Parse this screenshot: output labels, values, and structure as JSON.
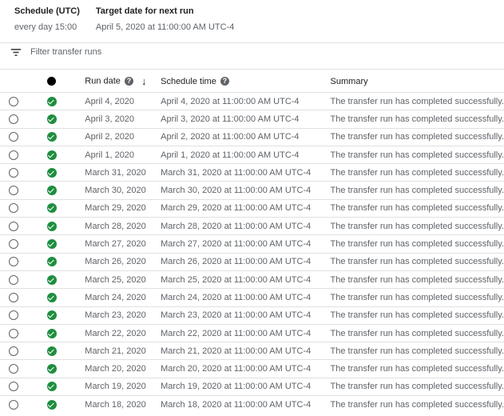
{
  "schedule": {
    "schedule_label": "Schedule (UTC)",
    "schedule_value": "every day 15:00",
    "target_label": "Target date for next run",
    "target_value": "April 5, 2020 at 11:00:00 AM UTC-4"
  },
  "filter": {
    "placeholder": "Filter transfer runs",
    "icon": "filter-icon"
  },
  "table": {
    "headers": {
      "run_date": "Run date",
      "schedule_time": "Schedule time",
      "summary": "Summary",
      "help_glyph": "?",
      "sort_glyph": "↓"
    },
    "status_color": "#1e8e3e",
    "rows": [
      {
        "run_date": "April 4, 2020",
        "schedule_time": "April 4, 2020 at 11:00:00 AM UTC-4",
        "summary": "The transfer run has completed successfully."
      },
      {
        "run_date": "April 3, 2020",
        "schedule_time": "April 3, 2020 at 11:00:00 AM UTC-4",
        "summary": "The transfer run has completed successfully."
      },
      {
        "run_date": "April 2, 2020",
        "schedule_time": "April 2, 2020 at 11:00:00 AM UTC-4",
        "summary": "The transfer run has completed successfully."
      },
      {
        "run_date": "April 1, 2020",
        "schedule_time": "April 1, 2020 at 11:00:00 AM UTC-4",
        "summary": "The transfer run has completed successfully."
      },
      {
        "run_date": "March 31, 2020",
        "schedule_time": "March 31, 2020 at 11:00:00 AM UTC-4",
        "summary": "The transfer run has completed successfully."
      },
      {
        "run_date": "March 30, 2020",
        "schedule_time": "March 30, 2020 at 11:00:00 AM UTC-4",
        "summary": "The transfer run has completed successfully."
      },
      {
        "run_date": "March 29, 2020",
        "schedule_time": "March 29, 2020 at 11:00:00 AM UTC-4",
        "summary": "The transfer run has completed successfully."
      },
      {
        "run_date": "March 28, 2020",
        "schedule_time": "March 28, 2020 at 11:00:00 AM UTC-4",
        "summary": "The transfer run has completed successfully."
      },
      {
        "run_date": "March 27, 2020",
        "schedule_time": "March 27, 2020 at 11:00:00 AM UTC-4",
        "summary": "The transfer run has completed successfully."
      },
      {
        "run_date": "March 26, 2020",
        "schedule_time": "March 26, 2020 at 11:00:00 AM UTC-4",
        "summary": "The transfer run has completed successfully."
      },
      {
        "run_date": "March 25, 2020",
        "schedule_time": "March 25, 2020 at 11:00:00 AM UTC-4",
        "summary": "The transfer run has completed successfully."
      },
      {
        "run_date": "March 24, 2020",
        "schedule_time": "March 24, 2020 at 11:00:00 AM UTC-4",
        "summary": "The transfer run has completed successfully."
      },
      {
        "run_date": "March 23, 2020",
        "schedule_time": "March 23, 2020 at 11:00:00 AM UTC-4",
        "summary": "The transfer run has completed successfully."
      },
      {
        "run_date": "March 22, 2020",
        "schedule_time": "March 22, 2020 at 11:00:00 AM UTC-4",
        "summary": "The transfer run has completed successfully."
      },
      {
        "run_date": "March 21, 2020",
        "schedule_time": "March 21, 2020 at 11:00:00 AM UTC-4",
        "summary": "The transfer run has completed successfully."
      },
      {
        "run_date": "March 20, 2020",
        "schedule_time": "March 20, 2020 at 11:00:00 AM UTC-4",
        "summary": "The transfer run has completed successfully."
      },
      {
        "run_date": "March 19, 2020",
        "schedule_time": "March 19, 2020 at 11:00:00 AM UTC-4",
        "summary": "The transfer run has completed successfully."
      },
      {
        "run_date": "March 18, 2020",
        "schedule_time": "March 18, 2020 at 11:00:00 AM UTC-4",
        "summary": "The transfer run has completed successfully."
      }
    ]
  }
}
